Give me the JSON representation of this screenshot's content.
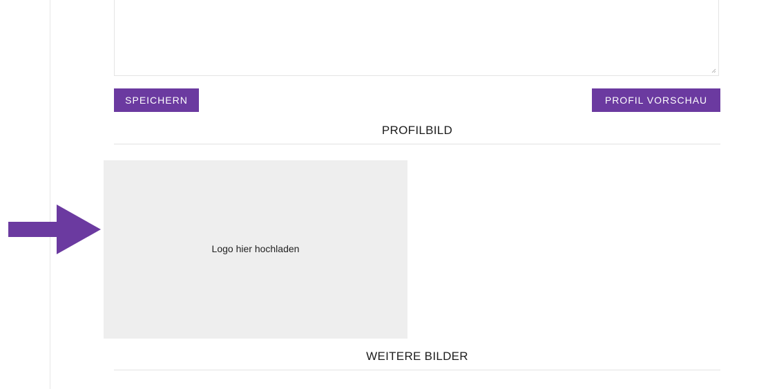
{
  "toolbar": {
    "save_label": "SPEICHERN",
    "preview_label": "PROFIL VORSCHAU"
  },
  "sections": {
    "profile_title": "PROFILBILD",
    "more_title": "WEITERE BILDER"
  },
  "upload": {
    "label": "Logo hier hochladen"
  },
  "colors": {
    "accent": "#6b3aa0",
    "dropzone": "#eeeeee"
  },
  "icons": {
    "arrow": "arrow-right-icon",
    "resize": "resize-grip-icon"
  }
}
